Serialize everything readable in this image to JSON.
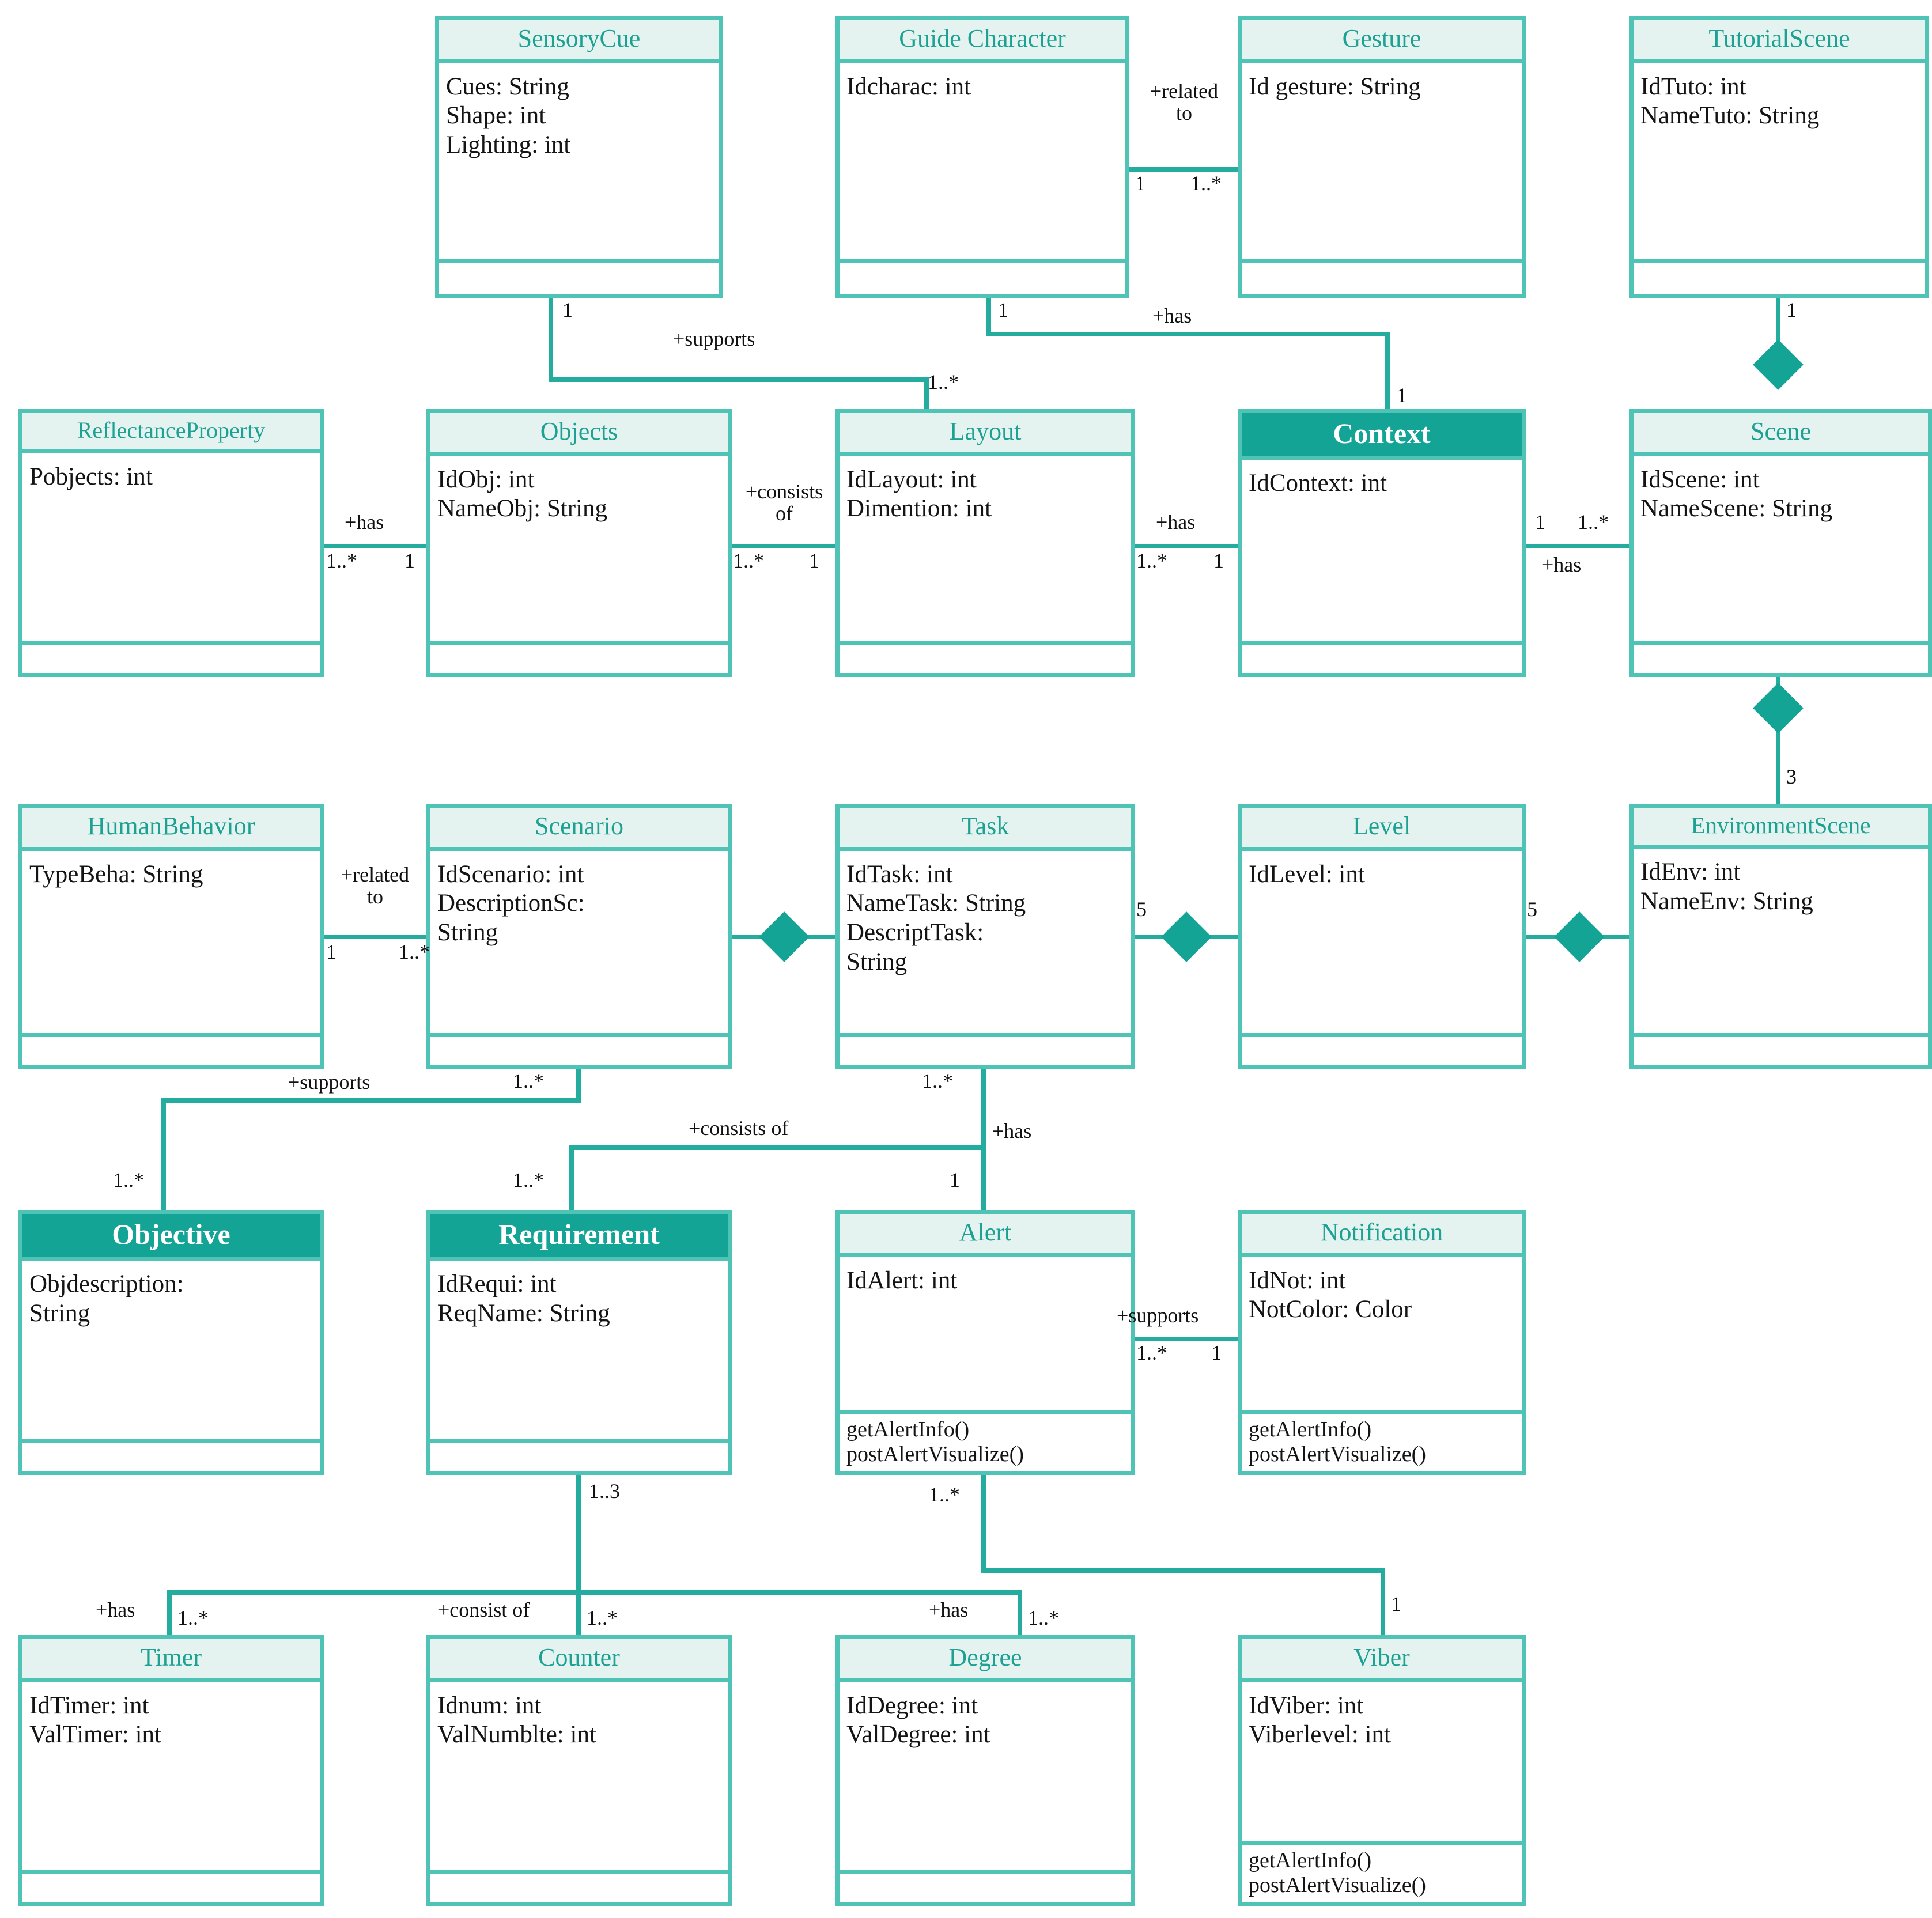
{
  "diagram": {
    "title": "UML class diagram",
    "colors": {
      "accent": "#13A496",
      "line": "#24AC9E",
      "border": "#4FC3B6",
      "header_light": "#E4F3F0",
      "header_dark": "#13A496",
      "text": "#141414",
      "class_title": "#1CA193"
    }
  },
  "classes": [
    {
      "id": "sensorycue",
      "name": "SensoryCue",
      "highlight": false,
      "attributes": [
        "Cues: String",
        "Shape: int",
        "Lighting: int"
      ],
      "operations": []
    },
    {
      "id": "guidechar",
      "name": "Guide Character",
      "highlight": false,
      "attributes": [
        "Idcharac: int"
      ],
      "operations": []
    },
    {
      "id": "gesture",
      "name": "Gesture",
      "highlight": false,
      "attributes": [
        "Id gesture: String"
      ],
      "operations": []
    },
    {
      "id": "tutorial",
      "name": "TutorialScene",
      "highlight": false,
      "attributes": [
        "IdTuto: int",
        "NameTuto: String"
      ],
      "operations": []
    },
    {
      "id": "reflectance",
      "name": "ReflectanceProperty",
      "highlight": false,
      "attributes": [
        "Pobjects: int"
      ],
      "operations": []
    },
    {
      "id": "objects",
      "name": "Objects",
      "highlight": false,
      "attributes": [
        "IdObj: int",
        "NameObj: String"
      ],
      "operations": []
    },
    {
      "id": "layout",
      "name": "Layout",
      "highlight": false,
      "attributes": [
        "IdLayout: int",
        "Dimention: int"
      ],
      "operations": []
    },
    {
      "id": "context",
      "name": "Context",
      "highlight": true,
      "attributes": [
        "IdContext: int"
      ],
      "operations": []
    },
    {
      "id": "scene",
      "name": "Scene",
      "highlight": false,
      "attributes": [
        "IdScene: int",
        "NameScene: String"
      ],
      "operations": []
    },
    {
      "id": "humanbeh",
      "name": "HumanBehavior",
      "highlight": false,
      "attributes": [
        "TypeBeha: String"
      ],
      "operations": []
    },
    {
      "id": "scenario",
      "name": "Scenario",
      "highlight": false,
      "attributes": [
        "IdScenario: int",
        "DescriptionSc:",
        "String"
      ],
      "operations": []
    },
    {
      "id": "task",
      "name": "Task",
      "highlight": false,
      "attributes": [
        "IdTask: int",
        "NameTask: String",
        "DescriptTask:",
        "String"
      ],
      "operations": []
    },
    {
      "id": "level",
      "name": "Level",
      "highlight": false,
      "attributes": [
        "IdLevel: int"
      ],
      "operations": []
    },
    {
      "id": "envscene",
      "name": "EnvironmentScene",
      "highlight": false,
      "attributes": [
        "IdEnv: int",
        "NameEnv: String"
      ],
      "operations": []
    },
    {
      "id": "objective",
      "name": "Objective",
      "highlight": true,
      "attributes": [
        "Objdescription:",
        "String"
      ],
      "operations": []
    },
    {
      "id": "requirement",
      "name": "Requirement",
      "highlight": true,
      "attributes": [
        "IdRequi: int",
        "ReqName: String"
      ],
      "operations": []
    },
    {
      "id": "alert",
      "name": "Alert",
      "highlight": false,
      "attributes": [
        "IdAlert: int"
      ],
      "operations": [
        "getAlertInfo()",
        "postAlertVisualize()"
      ]
    },
    {
      "id": "notification",
      "name": "Notification",
      "highlight": false,
      "attributes": [
        "IdNot: int",
        "NotColor: Color"
      ],
      "operations": [
        "getAlertInfo()",
        "postAlertVisualize()"
      ]
    },
    {
      "id": "timer",
      "name": "Timer",
      "highlight": false,
      "attributes": [
        "IdTimer: int",
        "ValTimer: int"
      ],
      "operations": []
    },
    {
      "id": "counter",
      "name": "Counter",
      "highlight": false,
      "attributes": [
        "Idnum: int",
        "ValNumblte: int"
      ],
      "operations": []
    },
    {
      "id": "degree",
      "name": "Degree",
      "highlight": false,
      "attributes": [
        "IdDegree: int",
        "ValDegree: int"
      ],
      "operations": []
    },
    {
      "id": "viber",
      "name": "Viber",
      "highlight": false,
      "attributes": [
        "IdViber: int",
        "Viberlevel: int"
      ],
      "operations": [
        "getAlertInfo()",
        "postAlertVisualize()"
      ]
    }
  ],
  "relationships": [
    {
      "id": "r1",
      "from": "guidechar",
      "to": "gesture",
      "label": "+related\nto",
      "from_mult": "1",
      "to_mult": "1..*"
    },
    {
      "id": "r2",
      "from": "sensorycue",
      "to": "layout",
      "label": "+supports",
      "from_mult": "1",
      "to_mult": "1..*"
    },
    {
      "id": "r3",
      "from": "guidechar",
      "to": "context",
      "label": "+has",
      "from_mult": "1",
      "to_mult": "1"
    },
    {
      "id": "r4",
      "from": "tutorial",
      "to": "scene",
      "label": "",
      "from_mult": "1",
      "to_mult": "",
      "kind": "composition"
    },
    {
      "id": "r5",
      "from": "reflectance",
      "to": "objects",
      "label": "+has",
      "from_mult": "1..*",
      "to_mult": "1"
    },
    {
      "id": "r6",
      "from": "objects",
      "to": "layout",
      "label": "+consists\nof",
      "from_mult": "1..*",
      "to_mult": "1"
    },
    {
      "id": "r7",
      "from": "layout",
      "to": "context",
      "label": "+has",
      "from_mult": "1..*",
      "to_mult": "1"
    },
    {
      "id": "r8",
      "from": "context",
      "to": "scene",
      "label": "+has",
      "from_mult": "1",
      "to_mult": "1..*"
    },
    {
      "id": "r9",
      "from": "scene",
      "to": "envscene",
      "label": "",
      "from_mult": "3",
      "to_mult": "",
      "kind": "composition"
    },
    {
      "id": "r10",
      "from": "humanbeh",
      "to": "scenario",
      "label": "+related\nto",
      "from_mult": "1",
      "to_mult": "1..*"
    },
    {
      "id": "r11",
      "from": "scenario",
      "to": "task",
      "label": "",
      "from_mult": "",
      "to_mult": "",
      "kind": "composition"
    },
    {
      "id": "r12",
      "from": "task",
      "to": "level",
      "label": "",
      "from_mult": "5",
      "to_mult": "",
      "kind": "composition"
    },
    {
      "id": "r13",
      "from": "level",
      "to": "envscene",
      "label": "",
      "from_mult": "5",
      "to_mult": "",
      "kind": "composition"
    },
    {
      "id": "r14",
      "from": "scenario",
      "to": "objective",
      "label": "+supports",
      "from_mult": "1..*",
      "to_mult": "1..*"
    },
    {
      "id": "r15",
      "from": "task",
      "to": "requirement",
      "label": "+consists of",
      "from_mult": "1..*",
      "to_mult": "1..*"
    },
    {
      "id": "r16",
      "from": "task",
      "to": "alert",
      "label": "+has",
      "from_mult": "1..*",
      "to_mult": "1"
    },
    {
      "id": "r17",
      "from": "alert",
      "to": "notification",
      "label": "+supports",
      "from_mult": "1..*",
      "to_mult": "1"
    },
    {
      "id": "r18",
      "from": "requirement",
      "to": "timer",
      "label": "+has",
      "from_mult": "1..3",
      "to_mult": "1..*"
    },
    {
      "id": "r19",
      "from": "requirement",
      "to": "counter",
      "label": "+consist of",
      "from_mult": "1..3",
      "to_mult": "1..*"
    },
    {
      "id": "r20",
      "from": "alert",
      "to": "degree",
      "label": "+has",
      "from_mult": "1..*",
      "to_mult": "1..*"
    },
    {
      "id": "r21",
      "from": "alert",
      "to": "viber",
      "label": "",
      "from_mult": "1..*",
      "to_mult": "1"
    }
  ],
  "edge_labels": {
    "related_to_1": "+related",
    "related_to_2": "to",
    "supports": "+supports",
    "has": "+has",
    "consists_of_1": "+consists",
    "consists_of_2": "of",
    "consists_of_inline": "+consists of",
    "consist_of_inline": "+consist of"
  },
  "multiplicities": {
    "one": "1",
    "one_many": "1..*",
    "one_three": "1..3",
    "three": "3",
    "five": "5"
  }
}
